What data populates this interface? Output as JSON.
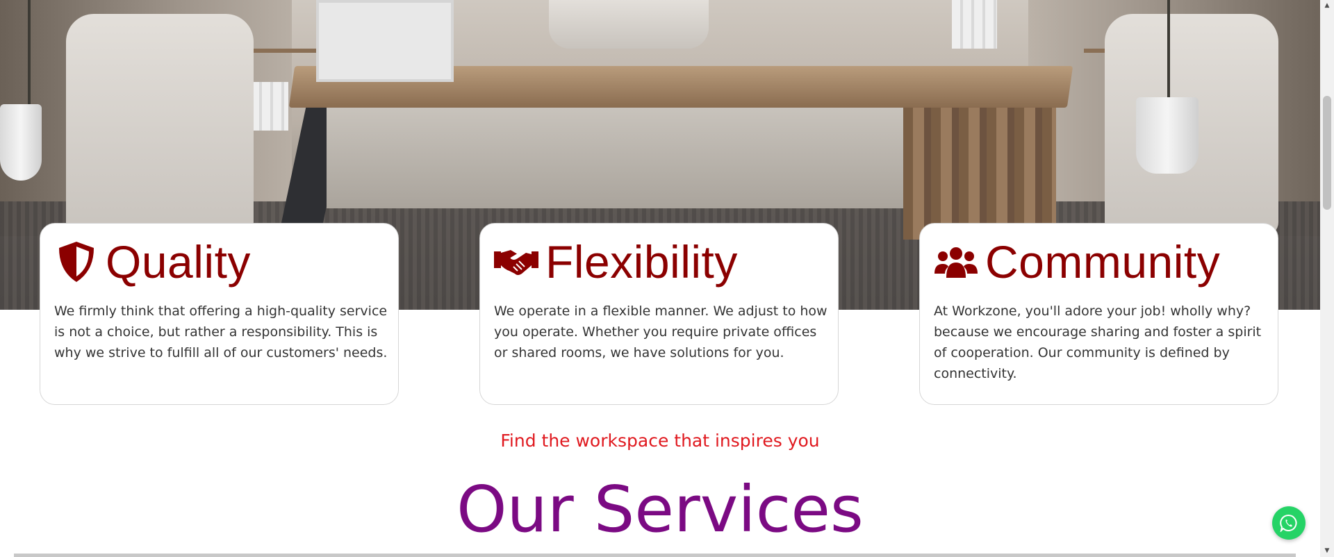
{
  "hero": {
    "image": "office-interior-photo"
  },
  "features": [
    {
      "icon": "shield-icon",
      "title": "Quality",
      "text": "We firmly think that offering a high-quality service is not a choice, but rather a responsibility. This is why we strive to fulfill all of our customers' needs."
    },
    {
      "icon": "handshake-icon",
      "title": "Flexibility",
      "text": "We operate in a flexible manner. We adjust to how you operate. Whether you require private offices or shared rooms, we have solutions for you."
    },
    {
      "icon": "users-icon",
      "title": "Community",
      "text": "At Workzone, you'll adore your job! wholly why? because we encourage sharing and foster a spirit of cooperation. Our community is defined by connectivity."
    }
  ],
  "tagline": "Find the workspace that inspires you",
  "services_heading": "Our Services",
  "floating": {
    "icon": "whatsapp-icon"
  },
  "colors": {
    "feature_title": "#8b0000",
    "tagline": "#e0191f",
    "services_heading": "#7b0a83",
    "whatsapp": "#25d366"
  }
}
